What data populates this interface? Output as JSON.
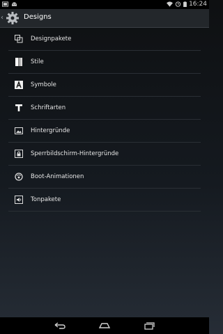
{
  "statusbar": {
    "time": "16:24",
    "icons": [
      "screenshot-icon",
      "android-icon",
      "wifi-icon",
      "battery-icon"
    ]
  },
  "actionbar": {
    "title": "Designs",
    "icon": "settings-gear-icon"
  },
  "items": [
    {
      "label": "Designpakete",
      "icon": "designpakete-icon"
    },
    {
      "label": "Stile",
      "icon": "stile-icon"
    },
    {
      "label": "Symbole",
      "icon": "symbole-icon"
    },
    {
      "label": "Schriftarten",
      "icon": "schriftarten-icon"
    },
    {
      "label": "Hintergründe",
      "icon": "hintergruende-icon"
    },
    {
      "label": "Sperrbildschirm-Hintergründe",
      "icon": "lockscreen-icon"
    },
    {
      "label": "Boot-Animationen",
      "icon": "boot-animation-icon"
    },
    {
      "label": "Tonpakete",
      "icon": "tonpakete-icon"
    }
  ],
  "navbar": {
    "buttons": [
      "back-icon",
      "home-icon",
      "recents-icon"
    ]
  }
}
